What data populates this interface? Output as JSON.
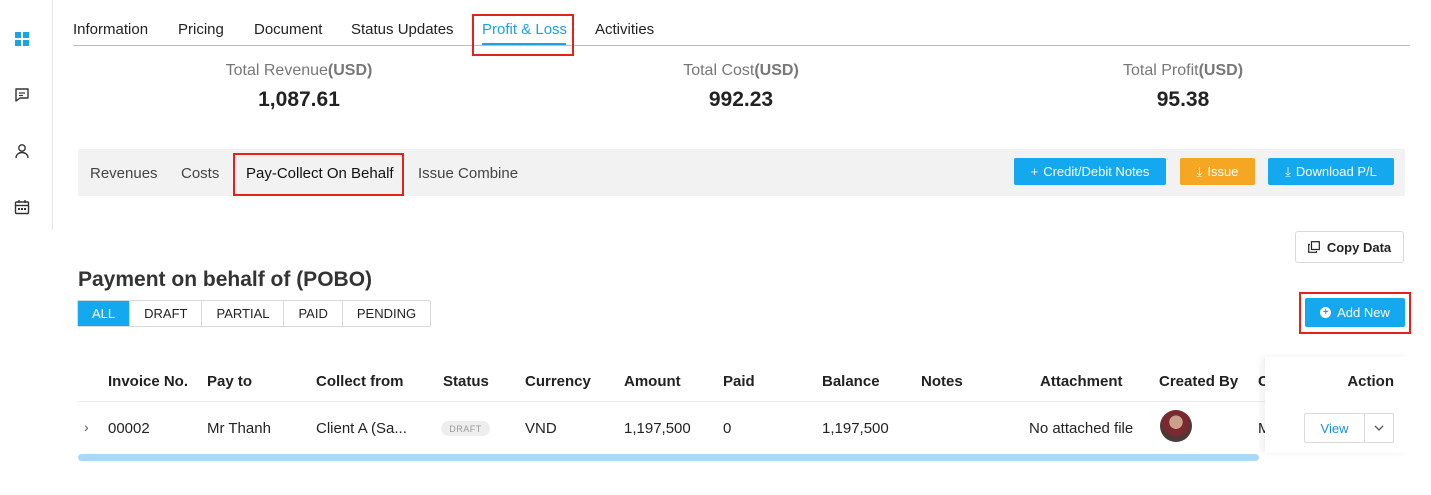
{
  "top_tabs": [
    {
      "label": "Information"
    },
    {
      "label": "Pricing"
    },
    {
      "label": "Document"
    },
    {
      "label": "Status Updates"
    },
    {
      "label": "Profit & Loss",
      "active": true
    },
    {
      "label": "Activities"
    }
  ],
  "totals": {
    "revenue": {
      "label": "Total Revenue",
      "unit": "(USD)",
      "value": "1,087.61"
    },
    "cost": {
      "label": "Total Cost",
      "unit": "(USD)",
      "value": "992.23"
    },
    "profit": {
      "label": "Total Profit",
      "unit": "(USD)",
      "value": "95.38"
    }
  },
  "sub_tabs": [
    {
      "label": "Revenues"
    },
    {
      "label": "Costs"
    },
    {
      "label": "Pay-Collect On Behalf",
      "active": true
    },
    {
      "label": "Issue Combine"
    }
  ],
  "toolbar": {
    "credit_debit_label": "Credit/Debit Notes",
    "issue_label": "Issue",
    "download_label": "Download P/L"
  },
  "copy_data_label": "Copy Data",
  "section_title": "Payment on behalf of (POBO)",
  "filters": [
    {
      "label": "ALL",
      "active": true
    },
    {
      "label": "DRAFT"
    },
    {
      "label": "PARTIAL"
    },
    {
      "label": "PAID"
    },
    {
      "label": "PENDING"
    }
  ],
  "add_new_label": "Add New",
  "table": {
    "columns": [
      "Invoice No.",
      "Pay to",
      "Collect from",
      "Status",
      "Currency",
      "Amount",
      "Paid",
      "Balance",
      "Notes",
      "Attachment",
      "Created By",
      "C",
      "Action"
    ],
    "rows": [
      {
        "invoice_no": "00002",
        "pay_to": "Mr Thanh",
        "collect_from": "Client A (Sa...",
        "status": "DRAFT",
        "currency": "VND",
        "amount": "1,197,500",
        "paid": "0",
        "balance": "1,197,500",
        "notes": "",
        "attachment": "No attached file",
        "created_by_avatar": "avatar",
        "c_partial": "M",
        "view_label": "View"
      }
    ]
  },
  "colors": {
    "accent": "#14a8ee",
    "orange": "#f5a623",
    "highlight_box": "#e2231a"
  }
}
